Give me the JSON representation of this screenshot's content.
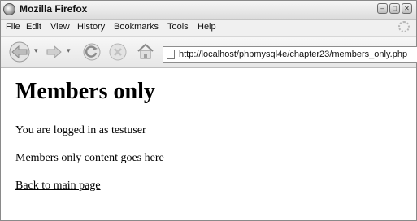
{
  "window": {
    "title": "Mozilla Firefox",
    "controls": [
      "minimize",
      "maximize",
      "close"
    ]
  },
  "menu": {
    "items": [
      "File",
      "Edit",
      "View",
      "History",
      "Bookmarks",
      "Tools",
      "Help"
    ]
  },
  "toolbar": {
    "url": "http://localhost/phpmysql4e/chapter23/members_only.php"
  },
  "page": {
    "heading": "Members only",
    "logged_in_text": "You are logged in as testuser",
    "content_text": "Members only content goes here",
    "link_text": "Back to main page"
  }
}
